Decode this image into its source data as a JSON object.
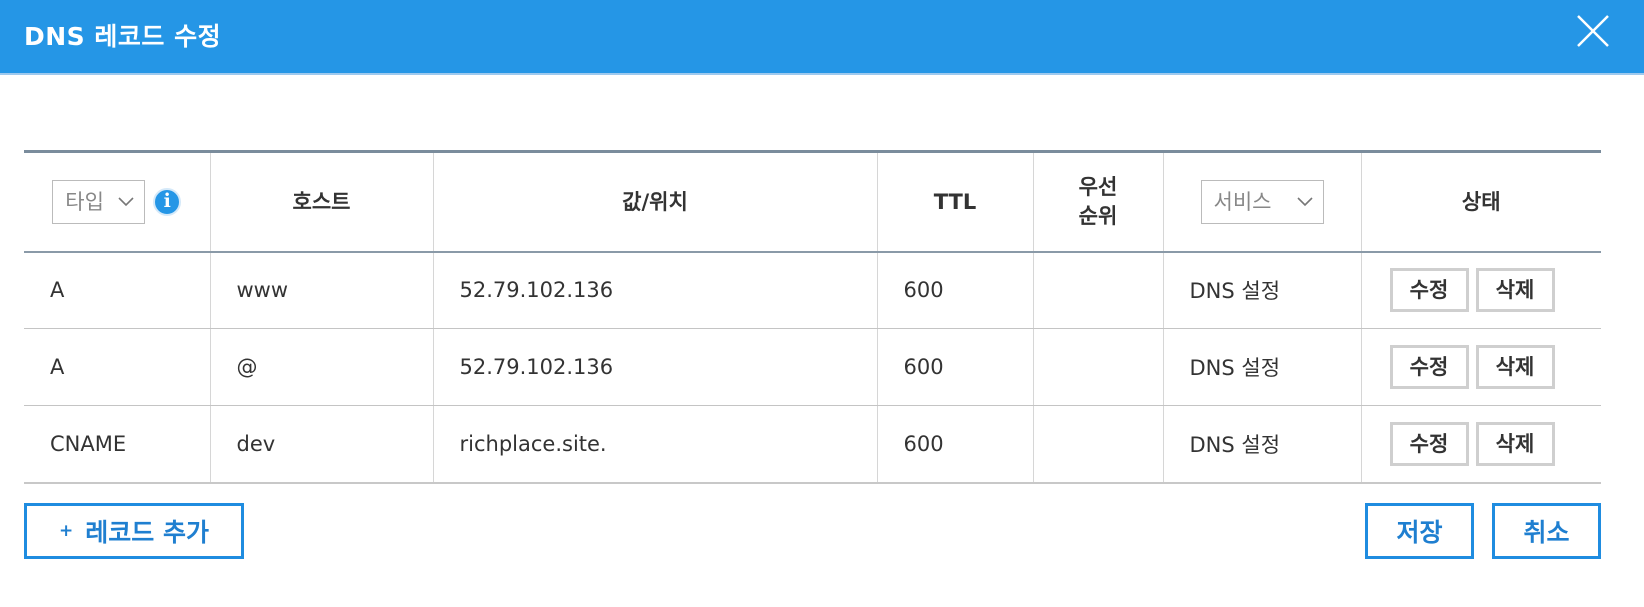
{
  "dialog": {
    "title": "DNS 레코드 수정"
  },
  "table": {
    "headers": {
      "type_filter": "타입",
      "host": "호스트",
      "value": "값/위치",
      "ttl": "TTL",
      "priority_line1": "우선",
      "priority_line2": "순위",
      "service_filter": "서비스",
      "status": "상태"
    },
    "rows": [
      {
        "type": "A",
        "host": "www",
        "value": "52.79.102.136",
        "ttl": "600",
        "priority": "",
        "service": "DNS 설정"
      },
      {
        "type": "A",
        "host": "@",
        "value": "52.79.102.136",
        "ttl": "600",
        "priority": "",
        "service": "DNS 설정"
      },
      {
        "type": "CNAME",
        "host": "dev",
        "value": "richplace.site.",
        "ttl": "600",
        "priority": "",
        "service": "DNS 설정"
      }
    ],
    "row_actions": {
      "edit_label": "수정",
      "delete_label": "삭제"
    }
  },
  "footer": {
    "add_record_plus": "+",
    "add_record_label": "레코드 추가",
    "save_label": "저장",
    "cancel_label": "취소"
  },
  "icons": {
    "close": "close-icon",
    "info": "info-icon",
    "dropdown": "chevron-down-icon"
  },
  "colors": {
    "header_bg": "#2596e6",
    "accent": "#1f8ce0"
  }
}
